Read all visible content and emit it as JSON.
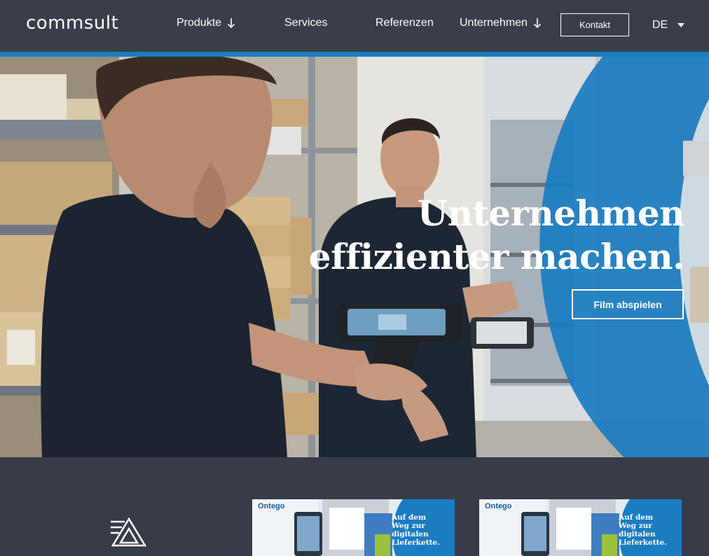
{
  "header": {
    "logo": "commsult",
    "nav": [
      {
        "label": "Produkte",
        "has_arrow": true
      },
      {
        "label": "Services",
        "has_arrow": false
      },
      {
        "label": "Referenzen",
        "has_arrow": false
      },
      {
        "label": "Unternehmen",
        "has_arrow": true
      }
    ],
    "contact_label": "Kontakt",
    "language": "DE"
  },
  "hero": {
    "headline_line1": "Unternehmen",
    "headline_line2": "effizienter machen.",
    "film_button": "Film abspielen"
  },
  "cards": [
    {
      "brand": "Ontego",
      "text": "Auf dem Weg zur digitalen Lieferkette."
    },
    {
      "brand": "Ontego",
      "text": "Auf dem Weg zur digitalen Lieferkette."
    }
  ],
  "colors": {
    "header_bg": "#3a3e4b",
    "accent_blue": "#1a7cc1",
    "section_bg": "#383c49"
  },
  "icons": {
    "arrow": "arrow-down-icon",
    "caret": "caret-down-icon",
    "section": "triangle-logo-icon"
  }
}
